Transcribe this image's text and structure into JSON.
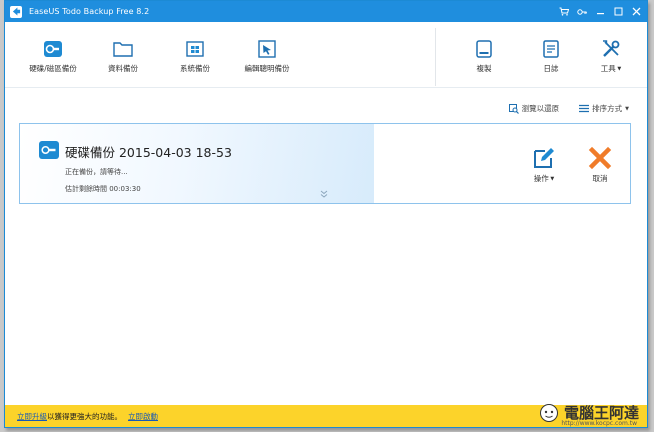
{
  "titlebar": {
    "title": "EaseUS Todo Backup Free 8.2",
    "icons": [
      "cart-icon",
      "key-icon",
      "minimize-icon",
      "maximize-icon",
      "close-icon"
    ]
  },
  "toolbar": {
    "disk_backup": "硬碟/磁區備份",
    "file_backup": "資料備份",
    "system_backup": "系統備份",
    "smart_backup": "編輯聰明備份",
    "clone": "複製",
    "logs": "日誌",
    "tools": "工具"
  },
  "sortbar": {
    "browse_restore": "瀏覽以還原",
    "sort": "排序方式"
  },
  "task": {
    "title": "硬碟備份 2015-04-03 18-53",
    "status": "正在備份，請等待...",
    "eta": "估計剩餘時間 00:03:30",
    "action_operate": "操作",
    "action_cancel": "取消"
  },
  "footer": {
    "upgrade_link": "立即升級",
    "upgrade_text": " 以獲得更強大的功能。",
    "activate_link": "立即啟動"
  },
  "watermark": {
    "text": "電腦王阿達",
    "url": "http://www.kocpc.com.tw"
  },
  "colors": {
    "titlebar": "#1f8ede",
    "accent": "#1e8ad2",
    "cancel": "#f07c2a",
    "footer": "#fcd32a"
  }
}
